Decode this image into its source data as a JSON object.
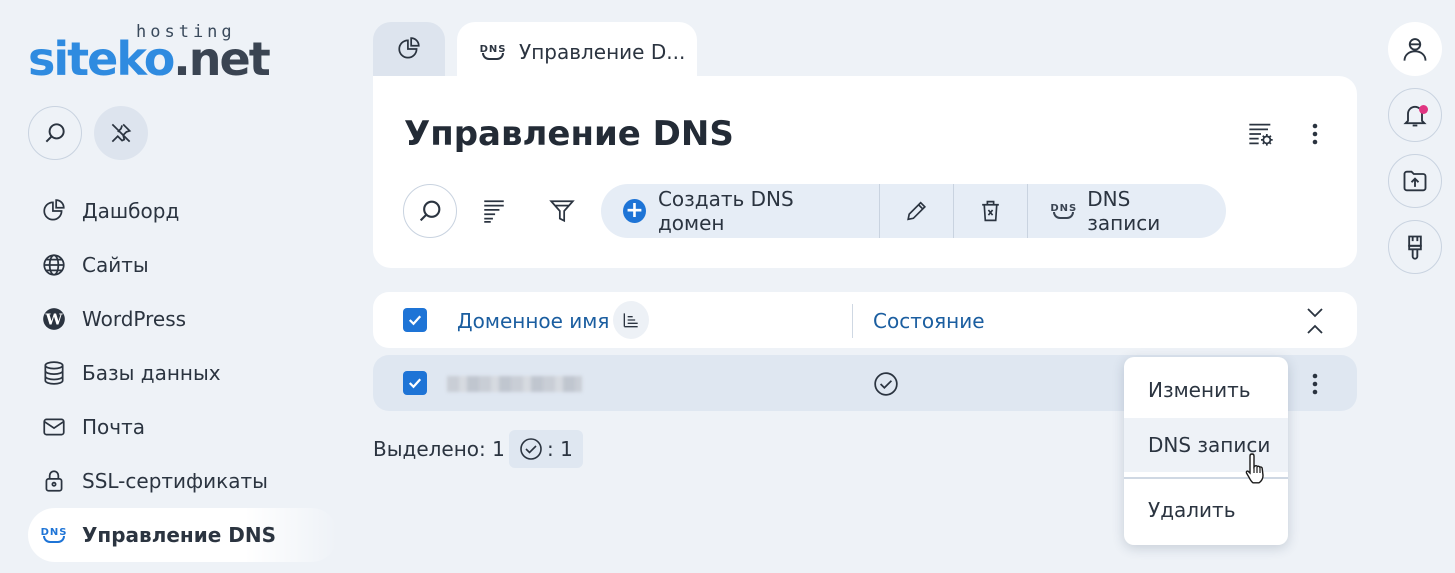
{
  "logo": {
    "brand_part1": "siteko",
    "brand_part2": ".net",
    "tagline": "hosting"
  },
  "sidebar": {
    "items": [
      {
        "label": "Дашборд",
        "icon": "pie-chart-icon"
      },
      {
        "label": "Сайты",
        "icon": "globe-icon"
      },
      {
        "label": "WordPress",
        "icon": "wordpress-icon"
      },
      {
        "label": "Базы данных",
        "icon": "database-icon"
      },
      {
        "label": "Почта",
        "icon": "mail-icon"
      },
      {
        "label": "SSL-сертификаты",
        "icon": "lock-icon"
      },
      {
        "label": "Управление DNS",
        "icon": "dns-icon",
        "active": true
      }
    ],
    "dns_badge": "DNS"
  },
  "tabs": {
    "active_label": "Управление D...",
    "dns_badge": "DNS"
  },
  "page": {
    "title": "Управление DNS"
  },
  "toolbar": {
    "create_label": "Создать DNS домен",
    "dns_records_label": "DNS записи",
    "dns_badge": "DNS"
  },
  "table": {
    "columns": {
      "domain": "Доменное имя",
      "state": "Состояние"
    },
    "rows": [
      {
        "domain": "",
        "checked": true,
        "state": "ok"
      }
    ]
  },
  "selection": {
    "label": "Выделено: 1",
    "count": ": 1"
  },
  "context_menu": {
    "items": [
      "Изменить",
      "DNS записи",
      "Удалить"
    ],
    "hovered_index": 1
  },
  "colors": {
    "accent": "#1e74d6",
    "background": "#eef2f7",
    "notification": "#e03582",
    "logo_blue": "#2f8be0"
  }
}
